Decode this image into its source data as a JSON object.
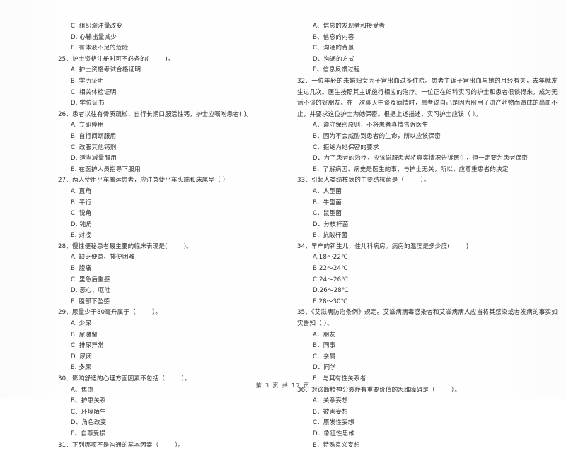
{
  "document": {
    "type": "scanned-exam-paper",
    "language": "zh-CN",
    "footer": "第 3 页  共 17 页"
  },
  "left_column": {
    "leading_options": [
      "C. 组织灌注量改变",
      "D. 心输出量减少",
      "E. 有体液不足的危险"
    ],
    "questions": [
      {
        "number": "25、",
        "stem": "护士资格注册时可不必备的(        )。",
        "options": [
          "A. 护士资格考试合格证明",
          "B. 学历证明",
          "C. 相关体检证明",
          "D. 学位证书"
        ]
      },
      {
        "number": "26、",
        "stem": "患者以往有骨质疏松，自行长期口服活性钙，护士应嘱咐患者(        )。",
        "options": [
          "A. 立即停用",
          "B. 自行间断服用",
          "C. 改服其他钙剂",
          "D. 适当减量服用",
          "E. 在医护人员指导下服用"
        ]
      },
      {
        "number": "27、",
        "stem": "两人使用平车搬运患者，应注意使平车头端和床尾呈（        ）",
        "options": [
          "A. 直角",
          "B. 平行",
          "C. 锐角",
          "D. 钝角",
          "E. 对接"
        ]
      },
      {
        "number": "28、",
        "stem": "慢性便秘患者最主要的临床表现是(        )。",
        "options": [
          "A. 缺乏便意、排便困难",
          "B. 腹痛",
          "C. 里急后重感",
          "D. 恶心、呕吐",
          "E. 腹部下坠感"
        ]
      },
      {
        "number": "29、",
        "stem": "尿量少于80毫升属于（        ）。",
        "options": [
          "A. 少尿",
          "B. 尿潴留",
          "C. 排尿异常",
          "D. 尿闭",
          "E. 多尿"
        ]
      },
      {
        "number": "30、",
        "stem": "影响舒适的心理方面因素不包括（        ）。",
        "options": [
          "A、焦虑",
          "B、护患关系",
          "C、环境陌生",
          "D、角色改变",
          "E、自尊受损"
        ]
      },
      {
        "number": "31、",
        "stem": "下列哪项不是沟通的基本因素（        ）。",
        "options": []
      }
    ]
  },
  "right_column": {
    "leading_options": [
      "A、信息的发现者和接受者",
      "B、信息的内容",
      "C、沟通的背景",
      "D、沟通的方式",
      "E、信息反馈过程"
    ],
    "questions": [
      {
        "number": "32、",
        "stem": "一位年轻的未婚妇女因子宫出血过多住院。患者主诉子宫出血与她的月经有关，去年就发生过几次。医生按照其主诉施行相应的治疗。一位正在妇科实习的护士和患者很谈得来，成为无话不谈的好朋友。在一次聊天中谈及病情时，患者说自己是因为服用了流产药物而造成的出血不止，并要求这位护士为她保密。根据上述描述，实习护士应该（        ）。",
        "options": [
          "A．遵守保密原则，不将患者真情告诉医生",
          "B．因为不会威胁到患者的生命，所以应该保密",
          "C．拒绝为她保密的要求",
          "D．为了患者的治疗，应该说服患者将真实情况告诉医生，但一定要为患者保密",
          "E．了解病因、病史是医生的事，与护士无关，所以，应尊重患者的决定"
        ]
      },
      {
        "number": "33、",
        "stem": "引起人类结核病的主要结核菌是（        ）。",
        "options": [
          "A．人型菌",
          "B．牛型菌",
          "C．鼠型菌",
          "D．分枝杆菌",
          "E．抗酸杆菌"
        ]
      },
      {
        "number": "34、",
        "stem": "早产的新生儿，住儿科病房。病房的温度是多少度(        )",
        "options": [
          "A.18～22℃",
          "B.22～24℃",
          "C.24～26℃",
          "D.26～28℃",
          "E.28～30℃"
        ]
      },
      {
        "number": "35、",
        "stem": "《艾滋病防治条例》规定。艾滋病病毒感染者和艾滋病病人应当将其感染或者发病的事实如实告知（        ）。",
        "options": [
          "A．朋友",
          "B．同事",
          "C．亲属",
          "D．同学",
          "E．与其有性关系者"
        ]
      },
      {
        "number": "36、",
        "stem": "对诊断精神分裂症有重要价值的思维障碍是（        ）。",
        "options": [
          "A．关系妄想",
          "B．被害妄想",
          "C．原发性妄想",
          "D．象征性思维",
          "E．特殊意义妄想"
        ]
      }
    ]
  }
}
